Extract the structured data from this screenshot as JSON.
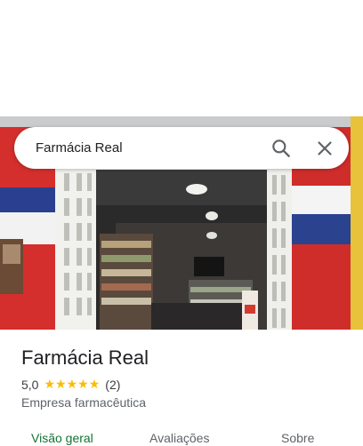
{
  "search": {
    "query": "Farmácia Real"
  },
  "place": {
    "name": "Farmácia Real",
    "rating": "5,0",
    "star_count": 5,
    "reviews": "(2)",
    "category": "Empresa farmacêutica"
  },
  "tabs": [
    {
      "label": "Visão geral",
      "active": true
    },
    {
      "label": "Avaliações",
      "active": false
    },
    {
      "label": "Sobre",
      "active": false
    }
  ],
  "colors": {
    "accent_green": "#137333",
    "star": "#fbbc04",
    "text_primary": "#202124",
    "text_secondary": "#5f6368"
  },
  "icons": {
    "search": "search-icon",
    "close": "close-icon"
  }
}
